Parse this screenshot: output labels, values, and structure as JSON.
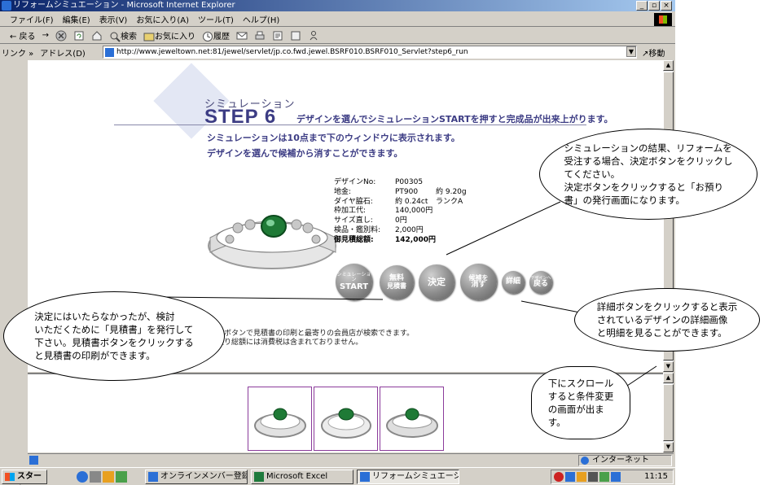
{
  "window": {
    "title": "リフォームシミュエーション - Microsoft Internet Explorer",
    "controls": [
      "_",
      "▫",
      "×"
    ]
  },
  "menu": [
    "ファイル(F)",
    "編集(E)",
    "表示(V)",
    "お気に入り(A)",
    "ツール(T)",
    "ヘルプ(H)"
  ],
  "toolbar": {
    "back": "← 戻る",
    "forward": "→",
    "search": "検索",
    "favorites": "お気に入り",
    "history": "履歴"
  },
  "address": {
    "links_label": "リンク »",
    "label": "アドレス(D)",
    "url": "http://www.jeweltown.net:81/jewel/servlet/jp.co.fwd.jewel.BSRF010.BSRF010_Servlet?step6_run",
    "go": "移動"
  },
  "page": {
    "sim_label": "シミュレーション",
    "step_title": "STEP 6",
    "step_desc": "デザインを選んでシミュレーションSTARTを押すと完成品が出来上がります。",
    "intro_line1": "シミュレーションは10点まで下のウィンドウに表示されます。",
    "intro_line2": "デザインを選んで候補から消すことができます。",
    "specs": [
      {
        "key": "デザインNo:",
        "value": "P00305",
        "extra": ""
      },
      {
        "key": "地金:",
        "value": "PT900",
        "extra": "約 9.20g"
      },
      {
        "key": "ダイヤ脇石:",
        "value": "約 0.24ct",
        "extra": "ランクA"
      },
      {
        "key": "枠加工代:",
        "value": "140,000円",
        "extra": ""
      },
      {
        "key": "サイズ直し:",
        "value": "0円",
        "extra": ""
      },
      {
        "key": "検品・鑑別料:",
        "value": "2,000円",
        "extra": ""
      },
      {
        "key": "御見積総額:",
        "value": "142,000円",
        "extra": ""
      }
    ],
    "buttons": {
      "start_top": "シミュレーション",
      "start": "START",
      "quote_1": "無料",
      "quote_2": "見積書",
      "decide": "決定",
      "remove_1": "候補を",
      "remove_2": "消す",
      "detail": "詳細",
      "back_top": "デザインへ",
      "back": "戻る"
    },
    "note1": "見積書ボタンで見積書の印刷と最寄りの会員店が検索できます。",
    "note2": "お見積り総額には消費税は含まれておりません。"
  },
  "callouts": {
    "decide": "シミュレーションの結果、リフォームを\n受注する場合、決定ボタンをクリックし\nてください。\n決定ボタンをクリックすると「お預り\n書」の発行画面になります。",
    "quote": "決定にはいたらなかったが、検討\nいただくために「見積書」を発行して\n下さい。見積書ボタンをクリックする\nと見積書の印刷ができます。",
    "detail": "詳細ボタンをクリックすると表示\nされているデザインの詳細画像\nと明細を見ることができます。",
    "scroll": "下にスクロール\nすると条件変更\nの画面が出ま\nす。"
  },
  "status": {
    "zone": "インターネット"
  },
  "taskbar": {
    "start": "スタート",
    "tasks": [
      "オンラインメンバー登録",
      "Microsoft Excel",
      "リフォームシミュエーション..."
    ],
    "clock": "11:15"
  },
  "colors": {
    "accent": "#3c3c84",
    "title_bar": "#0a246a",
    "thumb_border": "#8b3b9b"
  }
}
